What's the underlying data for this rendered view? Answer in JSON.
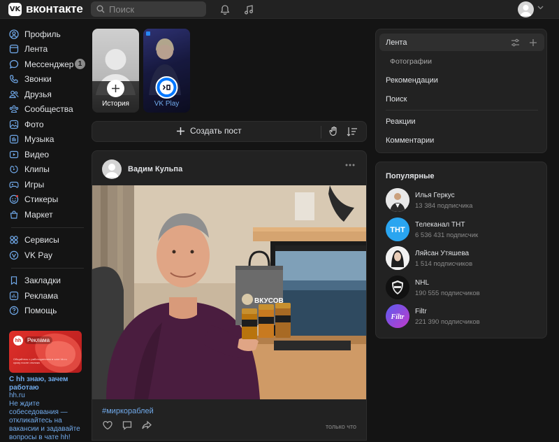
{
  "header": {
    "logo_badge": "VK",
    "logo_text": "вконтакте",
    "search_placeholder": "Поиск",
    "icons": [
      "search-icon",
      "bell-icon",
      "music-icon",
      "chevron-down-icon"
    ]
  },
  "sidebar": {
    "items": [
      {
        "label": "Профиль",
        "icon": "profile-icon"
      },
      {
        "label": "Лента",
        "icon": "feed-icon"
      },
      {
        "label": "Мессенджер",
        "icon": "messenger-icon",
        "badge": "1"
      },
      {
        "label": "Звонки",
        "icon": "phone-icon"
      },
      {
        "label": "Друзья",
        "icon": "friends-icon"
      },
      {
        "label": "Сообщества",
        "icon": "communities-icon"
      },
      {
        "label": "Фото",
        "icon": "photo-icon"
      },
      {
        "label": "Музыка",
        "icon": "music-icon"
      },
      {
        "label": "Видео",
        "icon": "video-icon"
      },
      {
        "label": "Клипы",
        "icon": "clips-icon"
      },
      {
        "label": "Игры",
        "icon": "games-icon"
      },
      {
        "label": "Стикеры",
        "icon": "stickers-icon"
      },
      {
        "label": "Маркет",
        "icon": "market-icon"
      }
    ],
    "items2": [
      {
        "label": "Сервисы",
        "icon": "services-icon"
      },
      {
        "label": "VK Pay",
        "icon": "vkpay-icon"
      }
    ],
    "items3": [
      {
        "label": "Закладки",
        "icon": "bookmarks-icon"
      },
      {
        "label": "Реклама",
        "icon": "ads-icon"
      },
      {
        "label": "Помощь",
        "icon": "help-icon"
      }
    ],
    "ad": {
      "tag": "Реклама",
      "small_text": "Общайтесь с работодателем в чате hh.ru сразу после отклика",
      "title": "С hh знаю, зачем работаю",
      "domain": "hh.ru",
      "description": "Не ждите собеседования — откликайтесь на вакансии и задавайте вопросы в чате hh!"
    }
  },
  "stories": [
    {
      "label": "История"
    },
    {
      "label": "VK Play"
    }
  ],
  "create_post": {
    "label": "Создать пост"
  },
  "post": {
    "author": "Вадим Кульпа",
    "bag_text": "ВКУСОВ",
    "hashtag": "#миркораблей",
    "time": "только что"
  },
  "feed_menu": {
    "items": [
      "Лента",
      "Фотографии",
      "Рекомендации",
      "Поиск",
      "Реакции",
      "Комментарии"
    ]
  },
  "popular": {
    "title": "Популярные",
    "items": [
      {
        "name": "Илья Геркус",
        "subs": "13 384 подписчика"
      },
      {
        "name": "Телеканал ТНТ",
        "subs": "6 536 431 подписчик"
      },
      {
        "name": "Ляйсан Утяшева",
        "subs": "1 514 подписчиков"
      },
      {
        "name": "NHL",
        "subs": "190 555 подписчиков"
      },
      {
        "name": "Filtr",
        "subs": "221 390 подписчиков"
      }
    ],
    "avatar_texts": [
      "ТНТ",
      "Filtr"
    ]
  },
  "colors": {
    "accent_link": "#71aaeb",
    "background": "#141414",
    "card": "#222222"
  }
}
